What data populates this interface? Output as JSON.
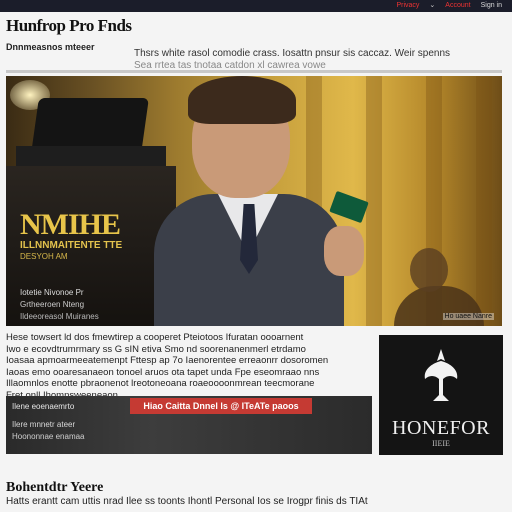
{
  "topbar": {
    "links": [
      "Privacy",
      "Account",
      "Sign in"
    ],
    "accent_color": "#e33333"
  },
  "masthead": {
    "logo": "Hunfrop Pro Fnds",
    "sublogo": "Dnnmeasnos mteeer",
    "headline": "Thsrs white rasol comodie crass. Iosattn pnsur sis caccaz. Weir spenns",
    "subheadline": "Sea rrtea tas tnotaa catdon xl cawrea vowe"
  },
  "hero": {
    "title": "NMIHE",
    "subtitle": "ILLNNMAITENTE TTE",
    "tagline": "DESYOH AM",
    "meta": [
      "Iotetie Nivonoe Pr",
      "Grtheeroen Nteng",
      "Ildeeoreasol Muiranes"
    ],
    "credit": "Ho uaee Nanre"
  },
  "article": {
    "lines": [
      "Hese towsert ld dos fmewtirep a cooperet Pteiotoos Ifuratan oooarnent",
      "Iwo e ecovdtrumrmary ss G sIN etiva Smo nd soorenanenmerl etrdamo",
      "Ioasaa apmoarmeeatemenpt Fttesp ap 7o Iaenorentee erreaonrr dosoromen",
      "Iaoas emo ooaresanaeon tonoel aruos ota tapet unda Fpe eseomraao nns",
      "Illaomnlos enotte pbraonenot lreotoneoana roaeoooonmrean teecmorane",
      "Fret onll Ihomnsweeneaon"
    ]
  },
  "promo": {
    "line1": "Ilene eoenaemrto",
    "button_label": "Hiao Caitta Dnnel ls @ ITeATe paoos",
    "line2": "Ilere mnnetr ateer",
    "line3": "Hoononnae enamaa"
  },
  "ad": {
    "brand": "HONEFOR",
    "tagline": "IIEIE",
    "bg_color": "#141414"
  },
  "section": {
    "title": "Bohentdtr Yeere",
    "text": "Hatts erantt cam uttis nrad Ilee ss toonts Ihontl Personal Ios se Irogpr finis ds TIAt"
  }
}
